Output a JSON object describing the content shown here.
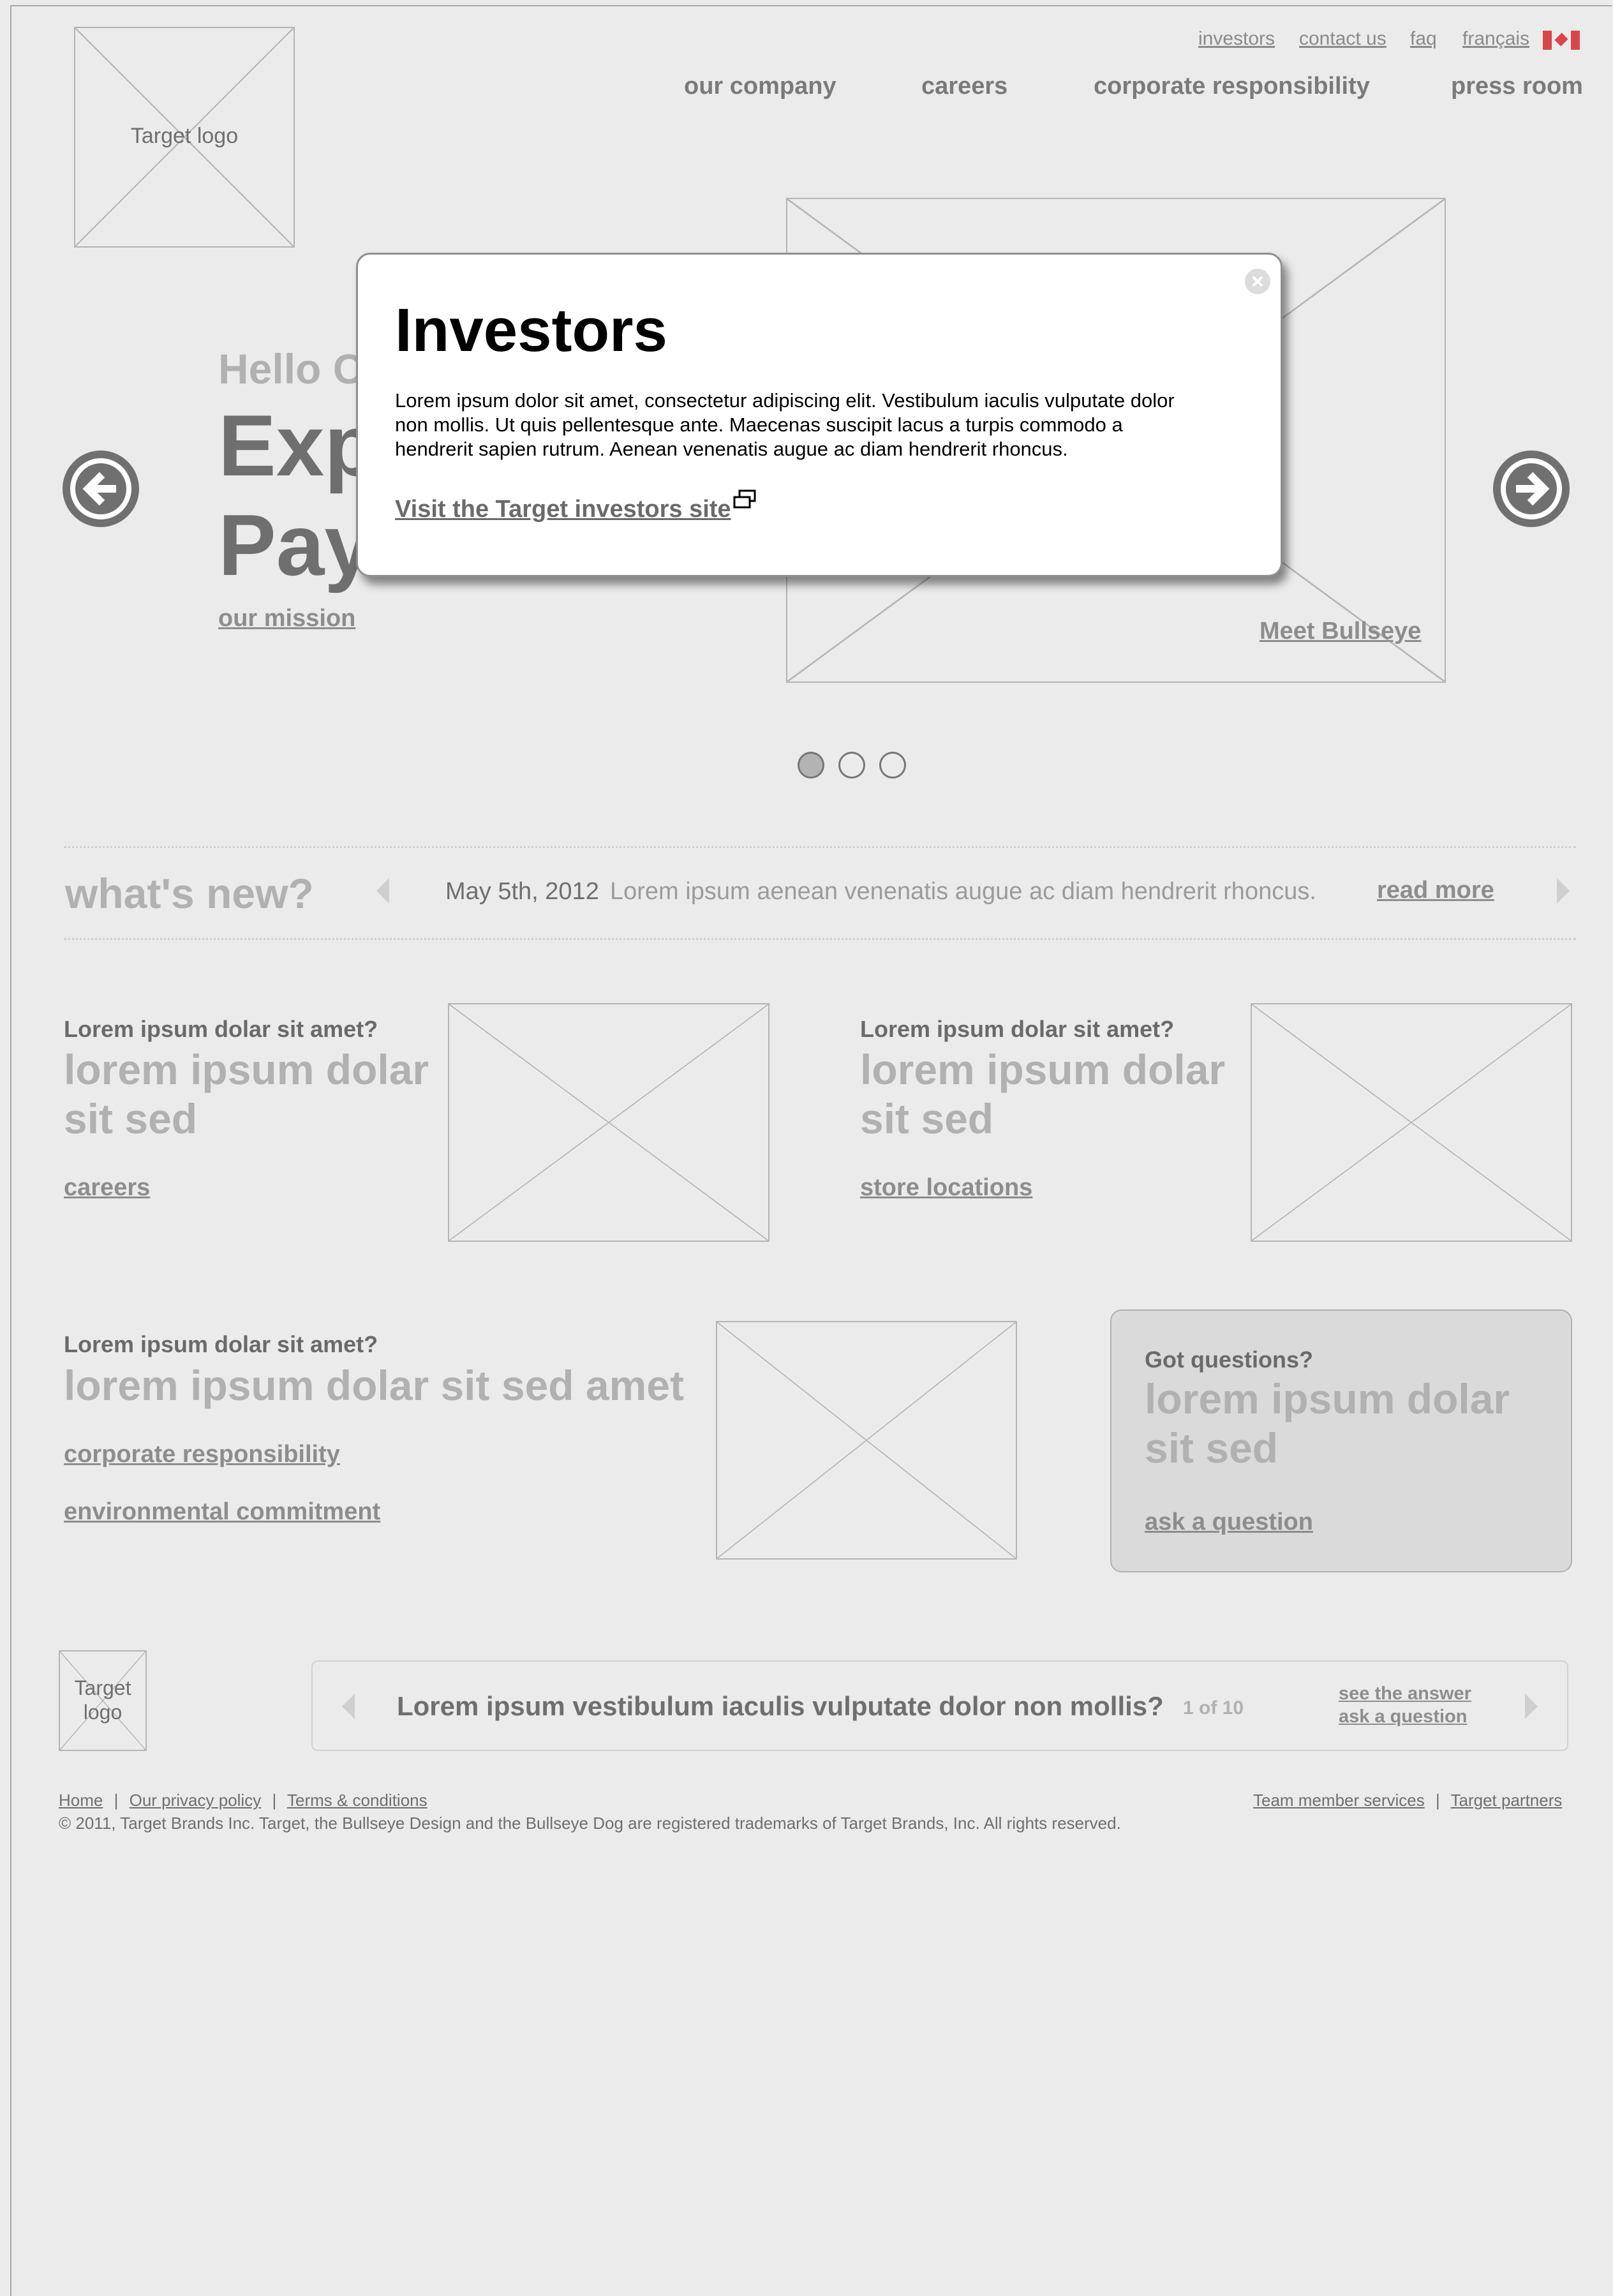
{
  "header": {
    "logo_label": "Target logo",
    "utility_links": [
      "investors",
      "contact us",
      "faq",
      "français"
    ],
    "nav": [
      "our company",
      "careers",
      "corporate responsibility",
      "press room"
    ]
  },
  "hero": {
    "hello": "Hello C",
    "headline_1": "Exp",
    "headline_2": "Pay",
    "mission_link": "our mission",
    "meet_link": "Meet Bullseye"
  },
  "modal": {
    "title": "Investors",
    "body": "Lorem ipsum dolor sit amet, consectetur adipiscing elit. Vestibulum iaculis vulputate dolor non mollis. Ut quis pellentesque ante. Maecenas suscipit lacus a turpis commodo a hendrerit sapien rutrum. Aenean venenatis augue ac diam hendrerit rhoncus.",
    "link": "Visit the Target investors site"
  },
  "whats_new": {
    "title": "what's new?",
    "date": "May 5th, 2012",
    "text": "Lorem ipsum aenean venenatis augue ac diam hendrerit rhoncus.",
    "read_more": "read more"
  },
  "promo_1": {
    "question": "Lorem ipsum dolar sit amet?",
    "line1": "lorem ipsum dolar",
    "line2": "sit sed",
    "link": "careers"
  },
  "promo_2": {
    "question": "Lorem ipsum dolar sit amet?",
    "line1": "lorem ipsum dolar",
    "line2": "sit sed",
    "link": "store locations"
  },
  "promo_3": {
    "question": "Lorem ipsum dolar sit amet?",
    "line1": "lorem ipsum dolar sit sed amet",
    "link1": "corporate responsibility",
    "link2": "environmental commitment"
  },
  "questions_box": {
    "title": "Got questions?",
    "line1": "lorem ipsum dolar",
    "line2": "sit sed",
    "link": "ask a question"
  },
  "faq_bar": {
    "logo_label": "Target logo",
    "question": "Lorem ipsum vestibulum iaculis vulputate dolor non mollis?",
    "counter": "1 of 10",
    "see_answer": "see the answer",
    "ask": "ask a question"
  },
  "footer": {
    "links_left": [
      "Home",
      "Our privacy policy",
      "Terms & conditions"
    ],
    "links_right": [
      "Team member services",
      "Target partners"
    ],
    "separator": "|",
    "copyright": "© 2011, Target Brands Inc. Target, the Bullseye Design and the Bullseye Dog are registered trademarks of Target Brands, Inc. All rights reserved."
  },
  "colors": {
    "background": "#ebebeb",
    "modal_bg": "#ffffff",
    "flag_red": "#d9464a"
  }
}
